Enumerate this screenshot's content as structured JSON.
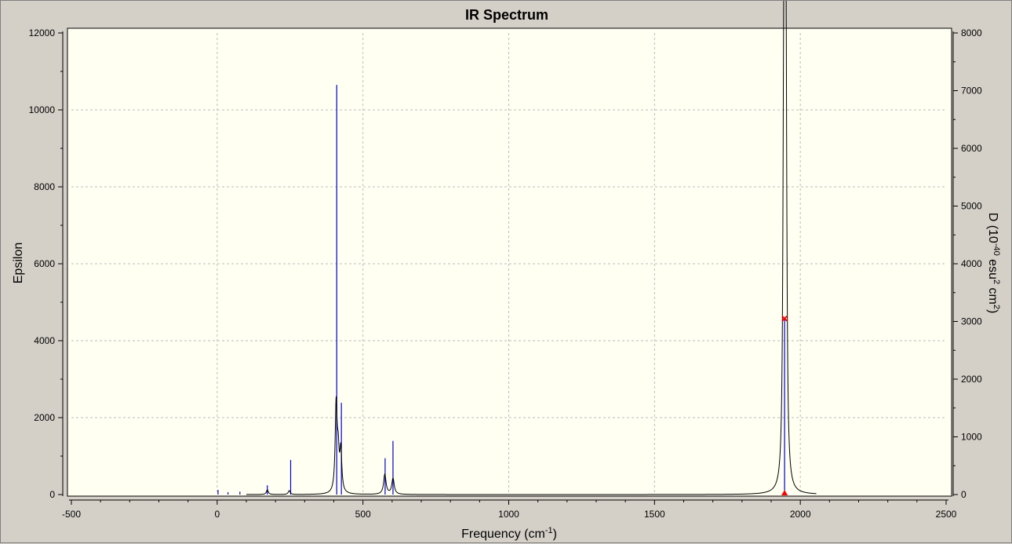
{
  "chart_data": {
    "type": "line",
    "title": "IR Spectrum",
    "xlabel": {
      "text": "Frequency (cm",
      "sup": "-1",
      "suffix": ")"
    },
    "ylabel_left": "Epsilon",
    "ylabel_right": {
      "p1": "D (10",
      "sup1": "-40",
      "p2": " esu",
      "sup2": "2",
      "p3": " cm",
      "sup3": "2",
      "p4": ")"
    },
    "xlim": [
      -500,
      2500
    ],
    "ylim_left": [
      0,
      12000
    ],
    "ylim_right": [
      0,
      8000
    ],
    "x_ticks": [
      -500,
      0,
      500,
      1000,
      1500,
      2000,
      2500
    ],
    "y_left_ticks": [
      0,
      2000,
      4000,
      6000,
      8000,
      10000,
      12000
    ],
    "y_right_ticks": [
      0,
      1000,
      2000,
      3000,
      4000,
      5000,
      6000,
      7000,
      8000
    ],
    "grid": true,
    "colors": {
      "background": "#fffff2",
      "spectrum": "#000000",
      "sticks": "#0000cc",
      "marker": "#ff0000",
      "grid": "#bdbdbd"
    },
    "series": [
      {
        "role": "spectrum",
        "axis": "left",
        "peaks": [
          {
            "x": 172,
            "y": 120
          },
          {
            "x": 247,
            "y": 100
          },
          {
            "x": 408,
            "y": 2250
          },
          {
            "x": 415,
            "y": 900
          },
          {
            "x": 424,
            "y": 1050
          },
          {
            "x": 575,
            "y": 520
          },
          {
            "x": 603,
            "y": 410
          },
          {
            "x": 1943,
            "y": 8000
          },
          {
            "x": 1947,
            "y": 9900
          },
          {
            "x": 1951,
            "y": 8900
          }
        ]
      },
      {
        "role": "sticks",
        "axis": "right",
        "points": [
          {
            "x": 3,
            "y": 80
          },
          {
            "x": 37,
            "y": 40
          },
          {
            "x": 78,
            "y": 50
          },
          {
            "x": 172,
            "y": 160
          },
          {
            "x": 252,
            "y": 600
          },
          {
            "x": 410,
            "y": 7100
          },
          {
            "x": 426,
            "y": 1590
          },
          {
            "x": 576,
            "y": 630
          },
          {
            "x": 603,
            "y": 930
          },
          {
            "x": 1946,
            "y": 3050
          }
        ]
      }
    ],
    "markers": [
      {
        "x": 1946,
        "y": 3050,
        "axis": "right",
        "shape": "x"
      },
      {
        "x": 1946,
        "y": 0,
        "axis": "right",
        "shape": "triangle"
      }
    ]
  }
}
